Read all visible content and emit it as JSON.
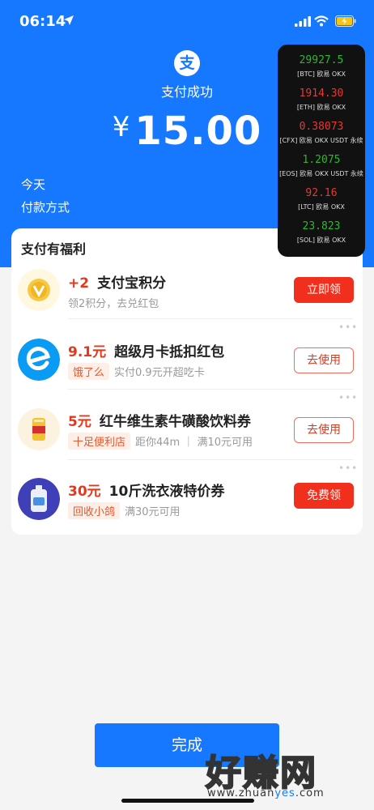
{
  "status_bar": {
    "time": "06:14"
  },
  "header": {
    "logo_char": "支",
    "title": "支付成功",
    "currency": "¥",
    "amount": "15.00",
    "date_label": "今天",
    "method_label": "付款方式"
  },
  "ticker": [
    {
      "price": "29927.5",
      "label": "[BTC] 欧易 OKX",
      "color": "#2eb82e"
    },
    {
      "price": "1914.30",
      "label": "[ETH] 欧易 OKX",
      "color": "#e53935"
    },
    {
      "price": "0.38073",
      "label": "[CFX] 欧易 OKX USDT 永续",
      "color": "#e53935"
    },
    {
      "price": "1.2075",
      "label": "[EOS] 欧易 OKX USDT 永续",
      "color": "#2eb82e"
    },
    {
      "price": "92.16",
      "label": "[LTC] 欧易 OKX",
      "color": "#e53935"
    },
    {
      "price": "23.823",
      "label": "[SOL] 欧易 OKX",
      "color": "#2eb82e"
    }
  ],
  "benefits": {
    "title": "支付有福利",
    "items": [
      {
        "accent": "+2",
        "title": "支付宝积分",
        "sub": "领2积分，去兑红包",
        "button": "立即领"
      },
      {
        "accent": "9.1元",
        "title": "超级月卡抵扣红包",
        "tag": "饿了么",
        "sub": "实付0.9元开超吃卡",
        "button": "去使用"
      },
      {
        "accent": "5元",
        "title": "红牛维生素牛磺酸饮料券",
        "tag": "十足便利店",
        "sub": "距你44m ｜ 满10元可用",
        "button": "去使用"
      },
      {
        "accent": "30元",
        "title": "10斤洗衣液特价券",
        "tag": "回收小鸽",
        "sub": "满30元可用",
        "button": "免费领"
      }
    ]
  },
  "done_button": "完成",
  "watermark": {
    "text": "好赚网",
    "url_prefix": "www.zhuan",
    "url_highlight": "yes",
    "url_suffix": ".com"
  },
  "colors": {
    "brand_blue": "#1677ff",
    "accent_red": "#e5371a",
    "button_red": "#f0301d"
  }
}
